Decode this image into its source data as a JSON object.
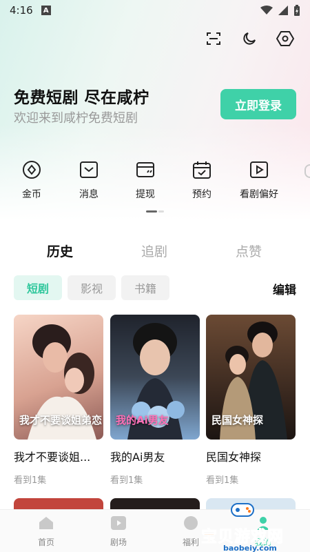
{
  "status_bar": {
    "time": "4:16",
    "notif_letter": "A"
  },
  "top_actions": [
    {
      "name": "scan-icon"
    },
    {
      "name": "moon-icon"
    },
    {
      "name": "settings-hexagon-icon"
    }
  ],
  "hero": {
    "title": "免费短剧 尽在咸柠",
    "subtitle": "欢迎来到咸柠免费短剧",
    "login_label": "立即登录",
    "accent": "#3fd1a8"
  },
  "quick_menu": [
    {
      "label": "金币",
      "icon": "coin-icon"
    },
    {
      "label": "消息",
      "icon": "message-icon"
    },
    {
      "label": "提现",
      "icon": "wallet-icon"
    },
    {
      "label": "预约",
      "icon": "calendar-icon"
    },
    {
      "label": "看剧偏好",
      "icon": "play-icon"
    }
  ],
  "tabs": [
    {
      "label": "历史",
      "active": true
    },
    {
      "label": "追剧",
      "active": false
    },
    {
      "label": "点赞",
      "active": false
    }
  ],
  "filters": {
    "chips": [
      {
        "label": "短剧",
        "active": true
      },
      {
        "label": "影视",
        "active": false
      },
      {
        "label": "书籍",
        "active": false
      }
    ],
    "edit_label": "编辑"
  },
  "history": [
    {
      "title": "我才不要谈姐...",
      "progress": "看到1集",
      "poster_text": "我才不要谈姐弟恋",
      "poster_colors": [
        "#f3c9b8",
        "#c98d80"
      ]
    },
    {
      "title": "我的Ai男友",
      "progress": "看到1集",
      "poster_text": "我的Ai男友",
      "poster_colors": [
        "#2b2f3a",
        "#8fb6d9"
      ]
    },
    {
      "title": "民国女神探",
      "progress": "看到1集",
      "poster_text": "民国女神探",
      "poster_colors": [
        "#5a3b2a",
        "#1f1a17"
      ]
    }
  ],
  "bottom_nav": [
    {
      "label": "首页",
      "icon": "home-icon",
      "active": false
    },
    {
      "label": "剧场",
      "icon": "theater-icon",
      "active": false
    },
    {
      "label": "福利",
      "icon": "gift-icon",
      "active": false
    },
    {
      "label": "我的",
      "icon": "profile-icon",
      "active": true
    }
  ],
  "watermark": {
    "text": "宝贝游戏网",
    "url": "baobeiy.com"
  }
}
